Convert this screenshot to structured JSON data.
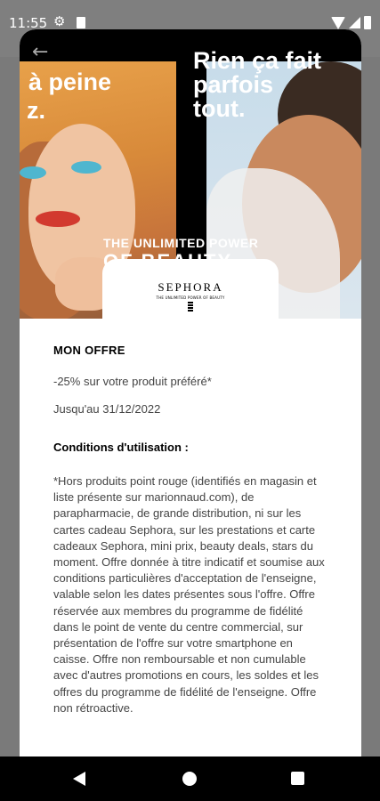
{
  "status_bar": {
    "time": "11:55"
  },
  "hero": {
    "left_line1": "à peine",
    "left_line2": "z.",
    "right_text": "Rien ça fait parfois tout.",
    "tagline": "THE UNLIMITED POWER",
    "tagline2": "OF BEAUTY"
  },
  "logo": {
    "name": "SEPHORA",
    "sub": "THE UNLIMITED POWER OF BEAUTY"
  },
  "offer": {
    "title": "MON OFFRE",
    "description": "-25% sur votre produit préféré*",
    "validity": "Jusqu'au 31/12/2022"
  },
  "conditions": {
    "title": "Conditions d'utilisation :",
    "text": "*Hors produits point rouge (identifiés en magasin et liste présente sur marionnaud.com), de parapharmacie, de grande distribution, ni sur les cartes cadeau Sephora, sur les prestations et carte cadeaux Sephora, mini prix, beauty deals, stars du moment. Offre donnée à titre indicatif et soumise aux conditions particulières d'acceptation de l'enseigne, valable selon les dates présentes sous l'offre. Offre réservée aux membres du programme de fidélité dans le point de vente du centre commercial, sur présentation de l'offre sur votre smartphone en caisse. Offre non remboursable et non cumulable avec d'autres promotions en cours, les soldes et les offres du programme de fidélité de l'enseigne. Offre non rétroactive."
  },
  "icons": {
    "back": "arrow-left-icon",
    "settings": "gear-icon",
    "sim": "sim-card-icon",
    "wifi": "wifi-icon",
    "signal": "signal-icon",
    "battery": "battery-icon"
  },
  "colors": {
    "accent_blue": "#4fb6cf",
    "lips": "#d23a2f"
  }
}
